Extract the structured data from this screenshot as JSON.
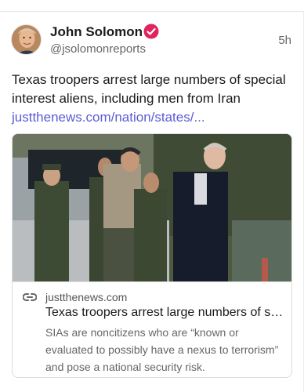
{
  "post": {
    "author_name": "John Solomon",
    "handle": "@jsolomonreports",
    "time": "5h",
    "text": "Texas troopers arrest large numbers of special interest aliens, including men from Iran ",
    "link_text": "justthenews.com/nation/states/..."
  },
  "icons": {
    "verified": "verified-badge-icon",
    "link": "link-icon"
  },
  "colors": {
    "verified_badge": "#e0245e",
    "link": "#5b5bd6"
  },
  "card": {
    "domain": "justthenews.com",
    "title": "Texas troopers arrest large numbers of special interest aliens, including men from Iran",
    "description": "SIAs are noncitizens who are “known or evaluated to possibly have a nexus to terrorism” and pose a national security risk."
  }
}
